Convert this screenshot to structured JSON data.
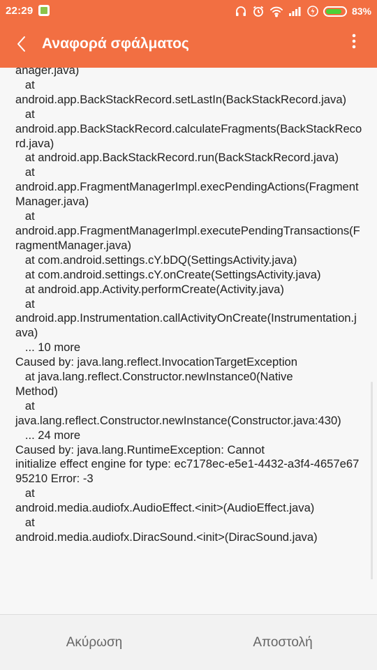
{
  "status_bar": {
    "time": "22:29",
    "battery_percent": "83%",
    "battery_level": 0.83,
    "icons": [
      "app-notification-icon",
      "headset-icon",
      "alarm-icon",
      "wifi-icon",
      "signal-icon",
      "charging-icon",
      "battery-icon"
    ]
  },
  "app_bar": {
    "title": "Αναφορά σφάλματος",
    "background_color": "#f26f42",
    "icons": [
      "back-arrow-icon",
      "more-vert-icon"
    ]
  },
  "log": {
    "text": "anager.java)\n   at\nandroid.app.BackStackRecord.setLastIn(BackStackRecord.java)\n   at\nandroid.app.BackStackRecord.calculateFragments(BackStackRecord.java)\n   at android.app.BackStackRecord.run(BackStackRecord.java)\n   at\nandroid.app.FragmentManagerImpl.execPendingActions(FragmentManager.java)\n   at\nandroid.app.FragmentManagerImpl.executePendingTransactions(FragmentManager.java)\n   at com.android.settings.cY.bDQ(SettingsActivity.java)\n   at com.android.settings.cY.onCreate(SettingsActivity.java)\n   at android.app.Activity.performCreate(Activity.java)\n   at\nandroid.app.Instrumentation.callActivityOnCreate(Instrumentation.java)\n   ... 10 more\nCaused by: java.lang.reflect.InvocationTargetException\n   at java.lang.reflect.Constructor.newInstance0(Native\nMethod)\n   at\njava.lang.reflect.Constructor.newInstance(Constructor.java:430)\n   ... 24 more\nCaused by: java.lang.RuntimeException: Cannot\ninitialize effect engine for type: ec7178ec-e5e1-4432-a3f4-4657e6795210 Error: -3\n   at\nandroid.media.audiofx.AudioEffect.<init>(AudioEffect.java)\n   at\nandroid.media.audiofx.DiracSound.<init>(DiracSound.java)"
  },
  "buttons": {
    "cancel_label": "Ακύρωση",
    "send_label": "Αποστολή"
  }
}
